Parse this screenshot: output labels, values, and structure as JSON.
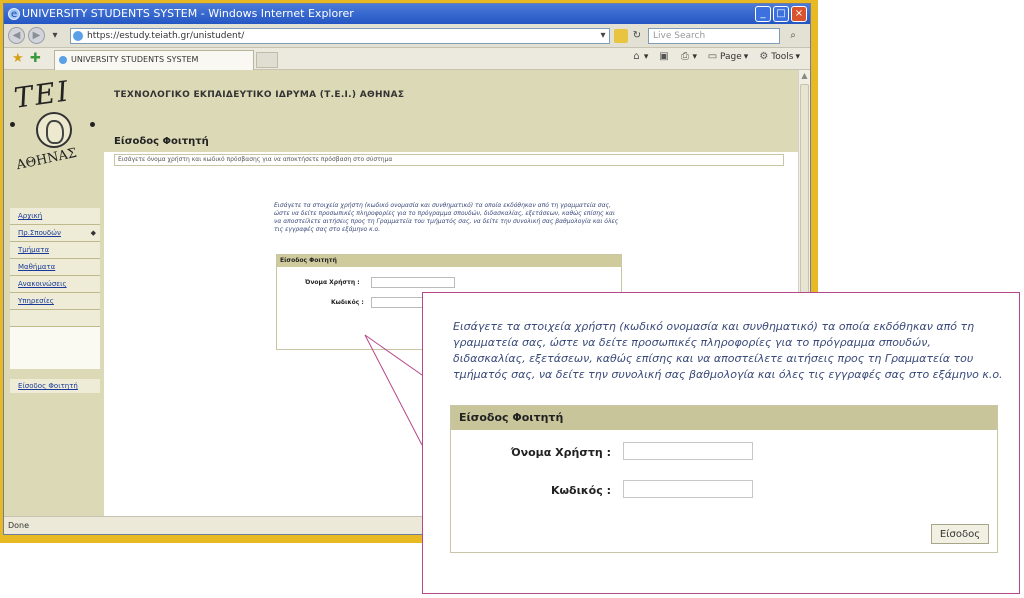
{
  "window": {
    "title": "UNIVERSITY STUDENTS SYSTEM - Windows Internet Explorer",
    "address_url": "https://estudy.teiath.gr/unistudent/",
    "search_placeholder": "Live Search",
    "tab_title": "UNIVERSITY STUDENTS SYSTEM",
    "command_page": "Page",
    "command_tools": "Tools",
    "status_text": "Done"
  },
  "site": {
    "logo_text": "ΤΕΙ",
    "logo_subtext": "ΑΘΗΝΑΣ",
    "institution": "ΤΕΧΝΟΛΟΓΙΚΟ ΕΚΠΑΙΔΕΥΤΙΚΟ ΙΔΡΥΜΑ (Τ.Ε.Ι.) ΑΘΗΝΑΣ",
    "section_title": "Είσοδος Φοιτητή",
    "subbar_text": "Εισάγετε όνομα χρήστη και κωδικό πρόσβασης για να αποκτήσετε πρόσβαση στο σύστημα"
  },
  "menu": {
    "items": [
      "Αρχική",
      "Πρ.Σπουδών",
      "Τμήματα",
      "Μαθήματα",
      "Ανακοινώσεις",
      "Υπηρεσίες"
    ],
    "login_link": "Είσοδος Φοιτητή"
  },
  "login": {
    "intro": "Εισάγετε τα στοιχεία χρήστη (κωδικό ονομασία και συνθηματικό) τα οποία εκδόθηκαν από τη γραμματεία σας, ώστε να δείτε προσωπικές πληροφορίες για το πρόγραμμα σπουδών, διδασκαλίας, εξετάσεων, καθώς επίσης και να αποστείλετε αιτήσεις προς τη Γραμματεία του τμήματός σας, να δείτε την συνολική σας βαθμολογία και όλες τις εγγραφές σας στο εξάμηνο κ.ο.",
    "box_title": "Είσοδος Φοιτητή",
    "username_label": "Όνομα Χρήστη :",
    "password_label": "Κωδικός :",
    "username_value": "",
    "password_value": "",
    "submit_label": "Είσοδος"
  },
  "colors": {
    "frame": "#e8b923",
    "header_bg": "#dcd9b6",
    "callout_border": "#b5478b",
    "box_header": "#c9c59a"
  }
}
